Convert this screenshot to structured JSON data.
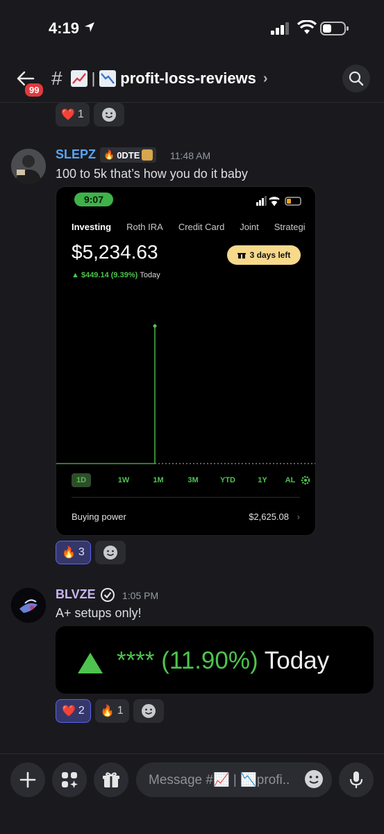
{
  "status_bar": {
    "time": "4:19"
  },
  "header": {
    "badge_count": "99",
    "channel_name": "profit-loss-reviews",
    "hash": "#",
    "separator": "|"
  },
  "top_reactions": [
    {
      "emoji": "❤️",
      "count": "1"
    }
  ],
  "messages": [
    {
      "username": "SLEPZ",
      "username_color": "#5aa4f2",
      "tag": "0DTE",
      "timestamp": "11:48 AM",
      "text": "100 to 5k that’s how you do it baby",
      "reactions": [
        {
          "emoji": "🔥",
          "count": "3",
          "active": true
        }
      ]
    },
    {
      "username": "BLVZE",
      "username_color": "#c7b6f0",
      "timestamp": "1:05 PM",
      "text": "A+ setups only!",
      "reactions": [
        {
          "emoji": "❤️",
          "count": "2",
          "active": true
        },
        {
          "emoji": "🔥",
          "count": "1",
          "active": false
        }
      ]
    }
  ],
  "robinhood": {
    "time": "9:07",
    "tabs": [
      "Investing",
      "Roth IRA",
      "Credit Card",
      "Joint",
      "Strategi"
    ],
    "value": "$5,234.63",
    "chip": "3 days left",
    "change": "$449.14 (9.39%)",
    "change_period": "Today",
    "ranges": [
      "1D",
      "1W",
      "1M",
      "3M",
      "YTD",
      "1Y",
      "AL"
    ],
    "buying_power_label": "Buying power",
    "buying_power_value": "$2,625.08"
  },
  "gain_box": {
    "masked": "****",
    "percent": "(11.90%)",
    "period": "Today"
  },
  "input": {
    "placeholder": "Message #📈 | 📉profi.."
  },
  "colors": {
    "accent": "#5865f2",
    "green": "#4ec44e",
    "background": "#1a1a1e"
  }
}
